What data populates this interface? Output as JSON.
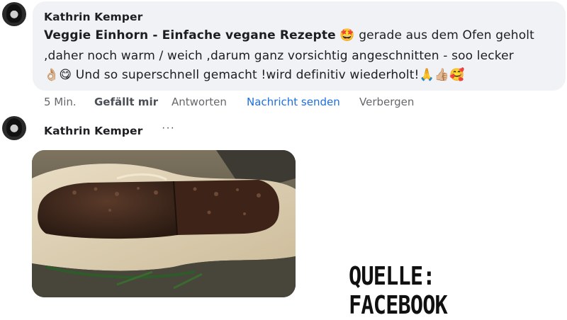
{
  "comment": {
    "author": "Kathrin Kemper",
    "page_link": "Veggie Einhorn - Einfache vegane Rezepte",
    "emoji_after_link": "🤩",
    "line1_rest": " gerade aus dem Ofen geholt",
    "line2": ",daher noch warm / weich ,darum ganz vorsichtig angeschnitten - soo lecker",
    "line3_emoji_start": "👌🏼😋",
    "line3_text": " Und so superschnell gemacht !wird definitiv wiederholt!",
    "line3_emoji_end": "🙏👍🏼🥰"
  },
  "actions": {
    "time": "5 Min.",
    "like": "Gefällt mir",
    "reply": "Antworten",
    "message": "Nachricht senden",
    "hide": "Verbergen"
  },
  "reply": {
    "author": "Kathrin Kemper",
    "more_label": "···",
    "photo_icon": "baked-loaf-photo"
  },
  "watermark": "QUELLE: FACEBOOK",
  "colors": {
    "bubble": "#f0f2f5",
    "link_blue": "#1d6fe1",
    "muted": "#65676b"
  }
}
